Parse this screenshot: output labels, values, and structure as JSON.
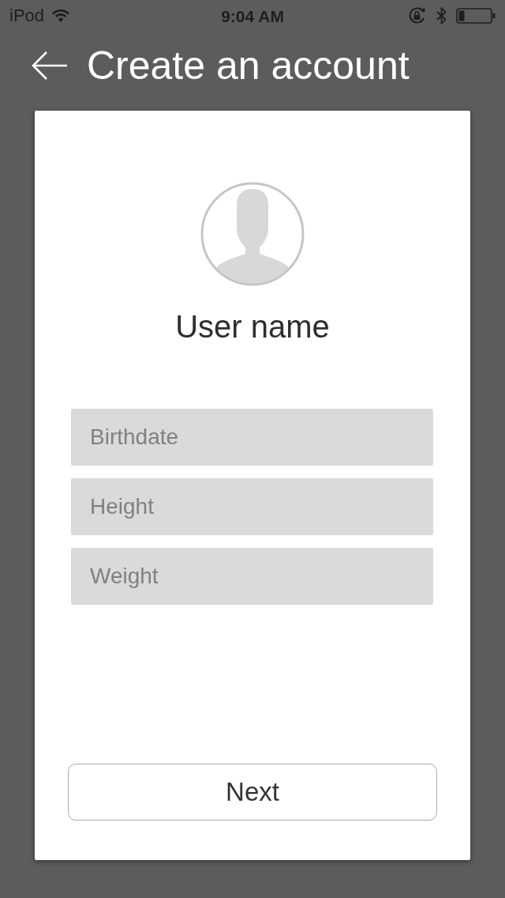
{
  "status_bar": {
    "carrier": "iPod",
    "time": "9:04 AM"
  },
  "header": {
    "title": "Create an account"
  },
  "profile": {
    "name": "User name"
  },
  "fields": [
    {
      "placeholder": "Birthdate"
    },
    {
      "placeholder": "Height"
    },
    {
      "placeholder": "Weight"
    }
  ],
  "next_button": {
    "label": "Next"
  }
}
